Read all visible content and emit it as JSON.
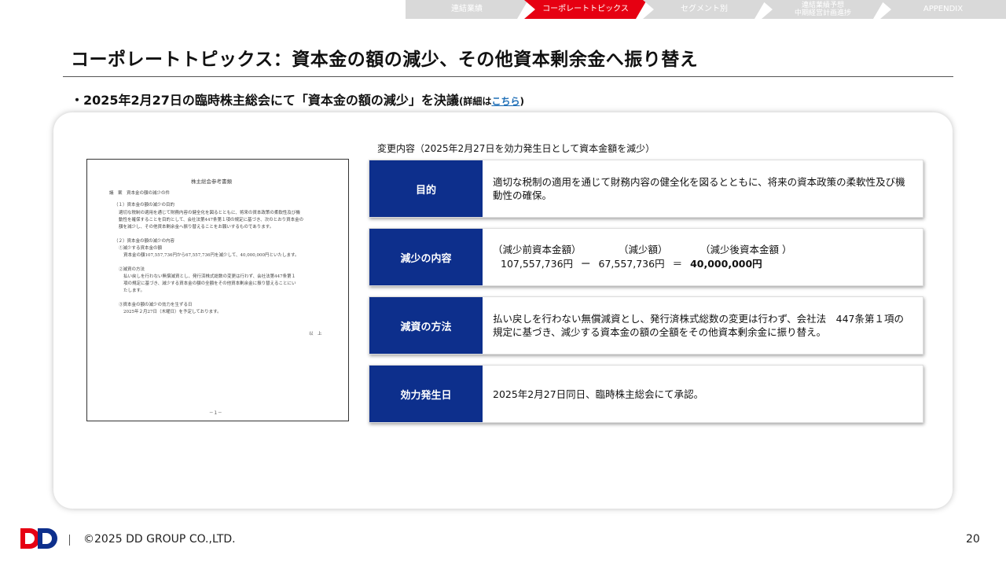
{
  "nav": {
    "tabs": [
      {
        "label": "連結業績",
        "active": false
      },
      {
        "label": "コーポレートトピックス",
        "active": true
      },
      {
        "label": "セグメント別",
        "active": false
      },
      {
        "label_line1": "連結業績予想",
        "label_line2": "中期経営計画進捗",
        "active": false
      },
      {
        "label": "APPENDIX",
        "active": false
      }
    ]
  },
  "title": "コーポレートトピックス：資本金の額の減少、その他資本剰余金へ振り替え",
  "bullet": {
    "main": "・2025年2月27日の臨時株主総会にて「資本金の額の減少」を決議",
    "detail_prefix": "(詳細は",
    "detail_link": "こちら",
    "detail_suffix": ")"
  },
  "document_thumbnail": {
    "heading": "株主総会参考書類",
    "lines": [
      "議　案　資本金の額の減少の件",
      "（１）資本金の額の減少の目的",
      "適切な税制の適用を通じて財務内容の健全化を図るとともに、将来の資本政策の柔軟性及び機",
      "動性を確保することを目的として、会社法第447条第１項の規定に基づき、次のとおり資本金の",
      "額を減少し、その他資本剰余金へ振り替えることをお願いするものであります。",
      "（２）資本金の額の減少の内容",
      "①減少する資本金の額",
      "資本金の額107,557,736円から67,557,736円を減少して、40,000,000円といたします。",
      "②減資の方法",
      "払い戻しを行わない無償減資とし、発行済株式総数の変更は行わず、会社法第447条第１",
      "項の規定に基づき、減少する資本金の額の全額をその他資本剰余金に振り替えることにい",
      "たします。",
      "③資本金の額の減少の効力を生ずる日",
      "2025年２月27日（木曜日）を予定しております。",
      "以　上",
      "－１－"
    ]
  },
  "change_caption": "変更内容（2025年2月27日を効力発生日として資本金額を減少）",
  "rows": [
    {
      "head": "目的",
      "body": "適切な税制の適用を通じて財務内容の健全化を図るとともに、将来の資本政策の柔軟性及び機動性の確保。"
    },
    {
      "head": "減少の内容",
      "labels": [
        "（減少前資本金額）",
        "（減少額）",
        "（減少後資本金額 ）"
      ],
      "before": "107,557,736円",
      "minus": "ー",
      "reduction": "67,557,736円",
      "equals": "＝",
      "after": "40,000,000円"
    },
    {
      "head": "減資の方法",
      "body": "払い戻しを行わない無償減資とし、発行済株式総数の変更は行わず、会社法　447条第１項の規定に基づき、減少する資本金の額の全額をその他資本剰余金に振り替え。"
    },
    {
      "head": "効力発生日",
      "body": "2025年2月27日同日、臨時株主総会にて承認。"
    }
  ],
  "footer": {
    "logo": "DD",
    "copyright": "©2025 DD GROUP CO.,LTD.",
    "page": "20"
  },
  "colors": {
    "accent_red": "#e60012",
    "header_navy": "#0d2f8c",
    "tab_grey": "#d9d9d9",
    "link": "#1f6fb7"
  }
}
